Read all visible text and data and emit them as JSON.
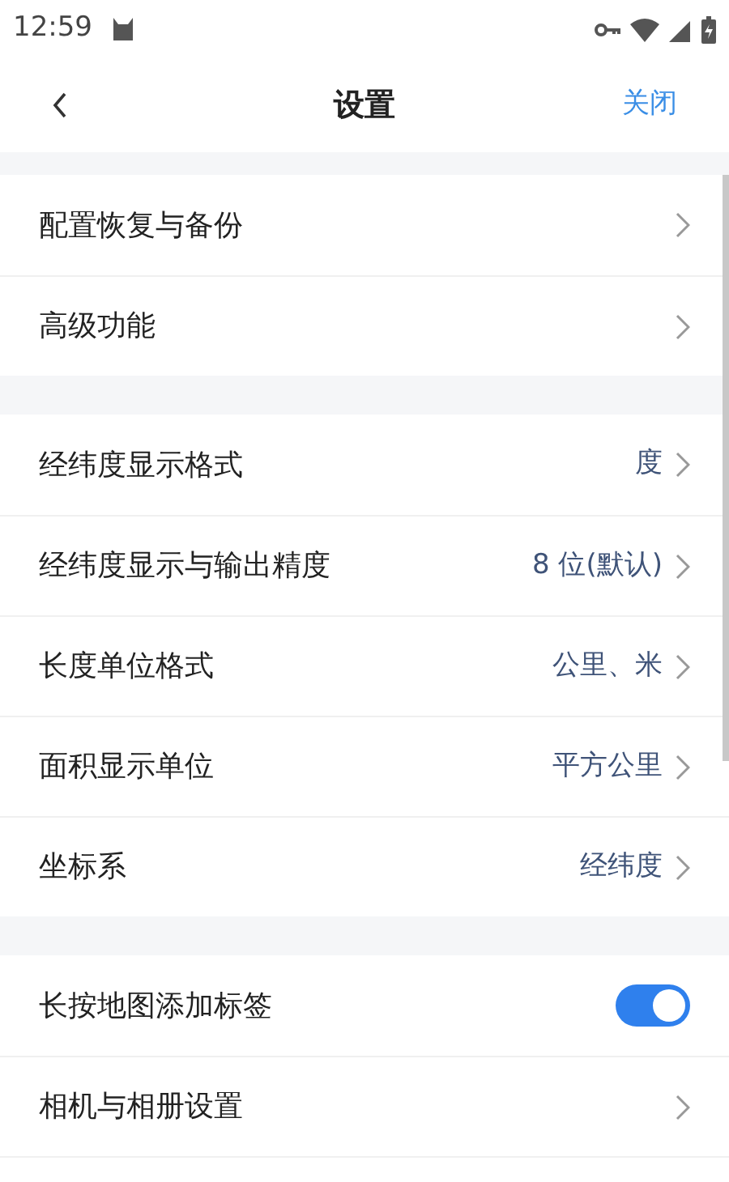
{
  "status_bar": {
    "time": "12:59"
  },
  "header": {
    "title": "设置",
    "close": "关闭"
  },
  "groups": [
    {
      "rows": [
        {
          "kind": "link",
          "label": "配置恢复与备份"
        },
        {
          "kind": "link",
          "label": "高级功能"
        }
      ]
    },
    {
      "rows": [
        {
          "kind": "link",
          "label": "经纬度显示格式",
          "value": "度"
        },
        {
          "kind": "link",
          "label": "经纬度显示与输出精度",
          "value": "8 位(默认)"
        },
        {
          "kind": "link",
          "label": "长度单位格式",
          "value": "公里、米"
        },
        {
          "kind": "link",
          "label": "面积显示单位",
          "value": "平方公里"
        },
        {
          "kind": "link",
          "label": "坐标系",
          "value": "经纬度"
        }
      ]
    },
    {
      "rows": [
        {
          "kind": "toggle",
          "label": "长按地图添加标签",
          "on": true
        },
        {
          "kind": "link",
          "label": "相机与相册设置"
        }
      ]
    }
  ]
}
